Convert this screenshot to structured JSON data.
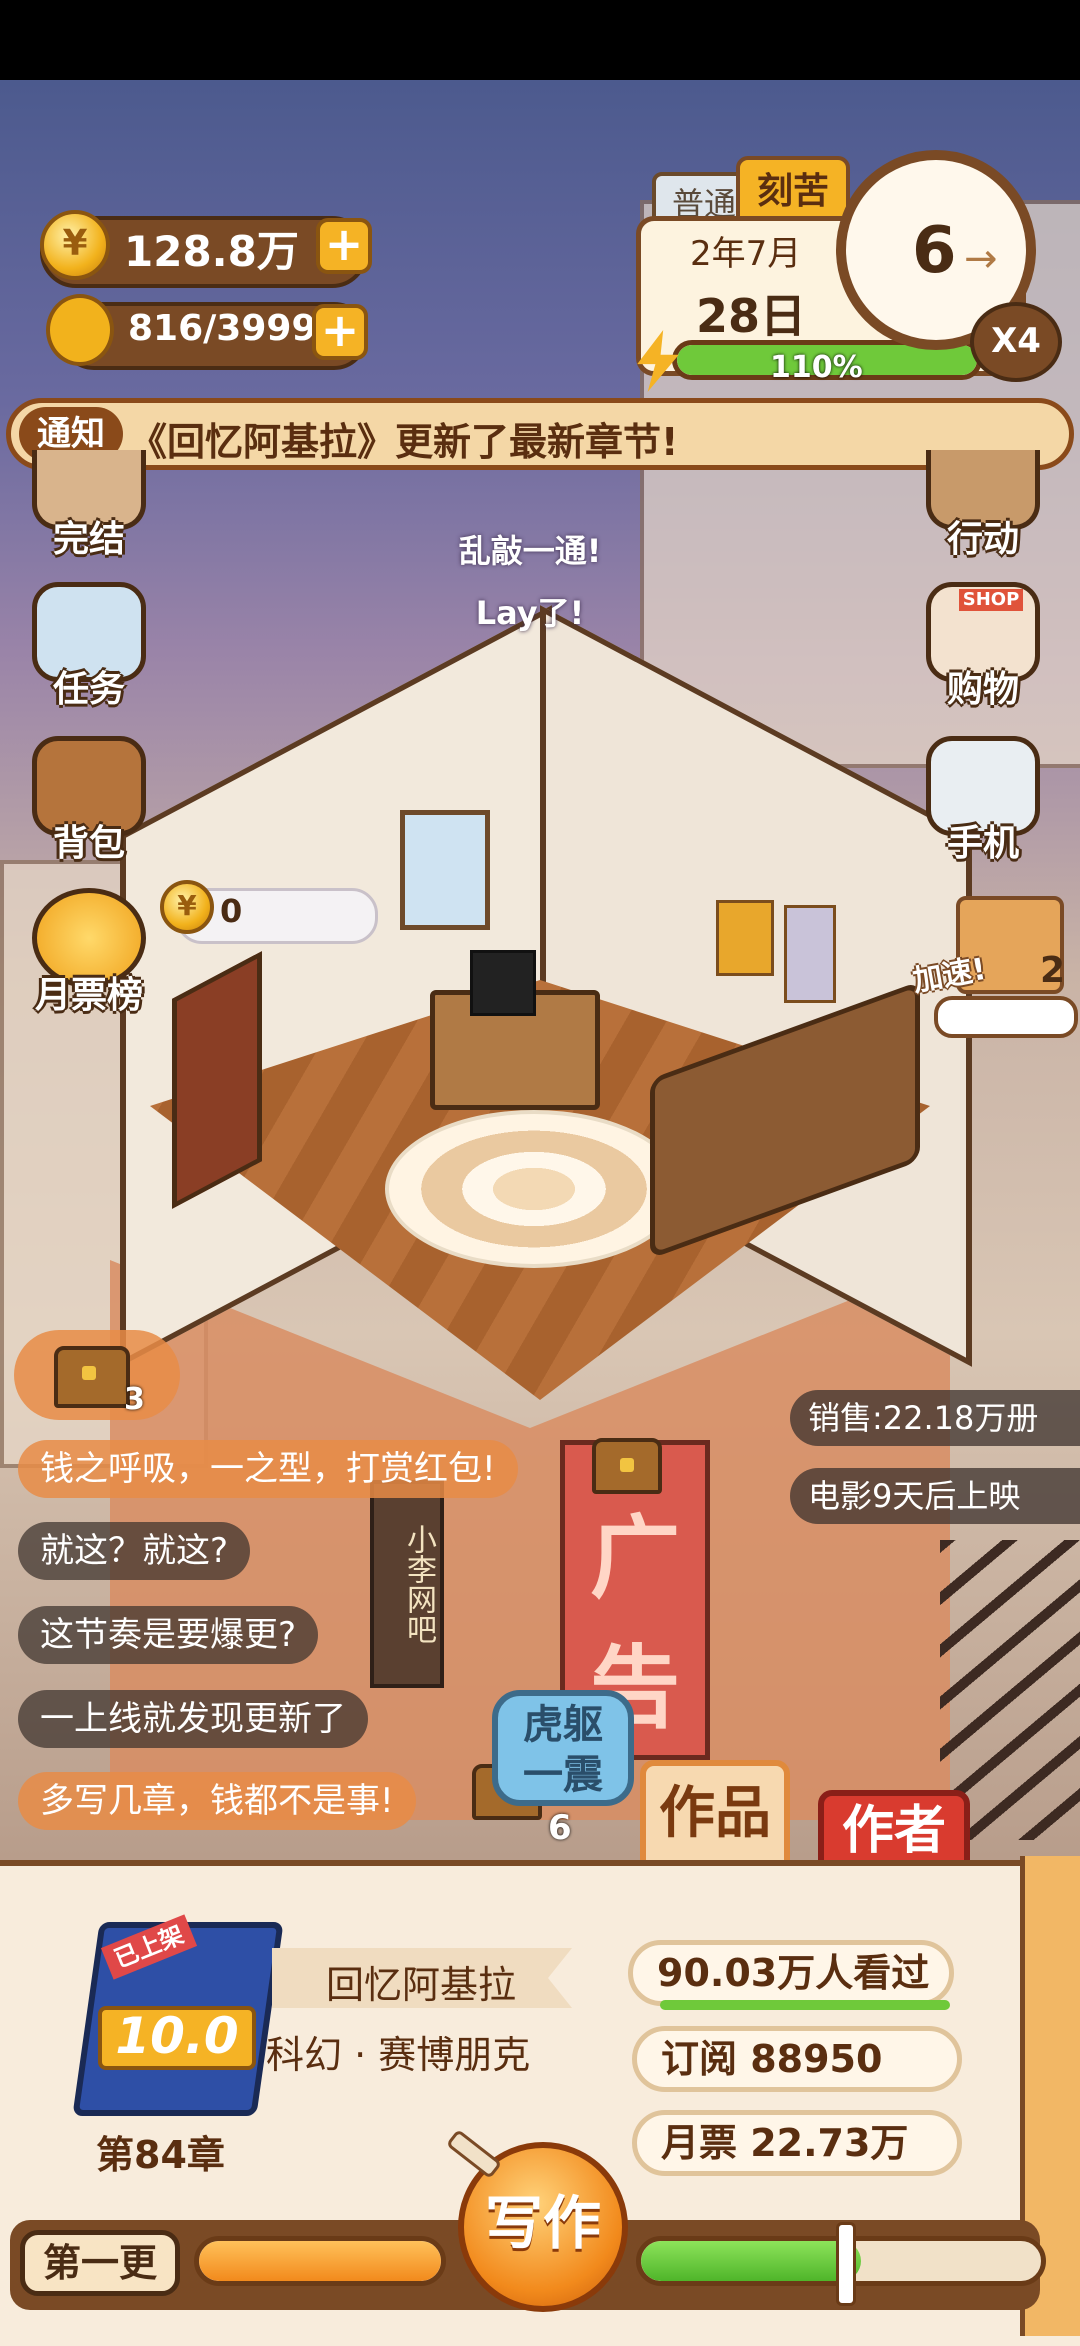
{
  "currency": {
    "coins": "128.8万",
    "energy": "816/3999",
    "coin_glyph": "¥"
  },
  "calendar": {
    "mode_tab": "普通",
    "effort_tab": "刻苦",
    "month": "2年7月",
    "day": "28日",
    "progress_pct": "110%",
    "progress_value": 1.1
  },
  "clock": {
    "speed": "6",
    "multiplier": "X4"
  },
  "notice": {
    "tag": "通知",
    "text": "《回忆阿基拉》更新了最新章节!"
  },
  "left_menu": [
    "完结",
    "任务",
    "背包",
    "月票榜"
  ],
  "right_menu": [
    "行动",
    "购物",
    "手机"
  ],
  "shop_sign": "SHOP",
  "moonticket_counter": "0",
  "bubbles": [
    "乱敲一通!",
    "Lay了!"
  ],
  "speedup": {
    "label": "加速!",
    "count": "2"
  },
  "sales": {
    "sold": "销售:22.18万册",
    "movie": "电影9天后上映"
  },
  "chest_counts": {
    "top": "3",
    "bottom": "6"
  },
  "comments": [
    {
      "text": "钱之呼吸，一之型，打赏红包!",
      "highlight": true
    },
    {
      "text": "就这？就这?",
      "highlight": false
    },
    {
      "text": "这节奏是要爆更?",
      "highlight": false
    },
    {
      "text": "一上线就发现更新了",
      "highlight": false
    },
    {
      "text": "多写几章，钱都不是事!",
      "highlight": true
    }
  ],
  "action_button": "虎躯一震",
  "tabs": {
    "works": "作品",
    "author": "作者"
  },
  "scene_signs": {
    "ad": "广告",
    "netcafe": "小李网吧"
  },
  "book": {
    "badge": "已上架",
    "score": "10.0",
    "title": "回忆阿基拉",
    "genre": "科幻 · 赛博朋克",
    "chapter": "第84章",
    "views": "90.03万人看过",
    "subscribe": "订阅 88950",
    "monthly": "月票 22.73万"
  },
  "bottom": {
    "update_label": "第一更",
    "write_button": "写作",
    "left_progress": 1.0,
    "right_progress": 0.55
  },
  "colors": {
    "accent": "#f5b325",
    "dark_brown": "#4a2c14",
    "green": "#6fc93a",
    "orange": "#f29a3c",
    "red": "#d93b2f"
  }
}
